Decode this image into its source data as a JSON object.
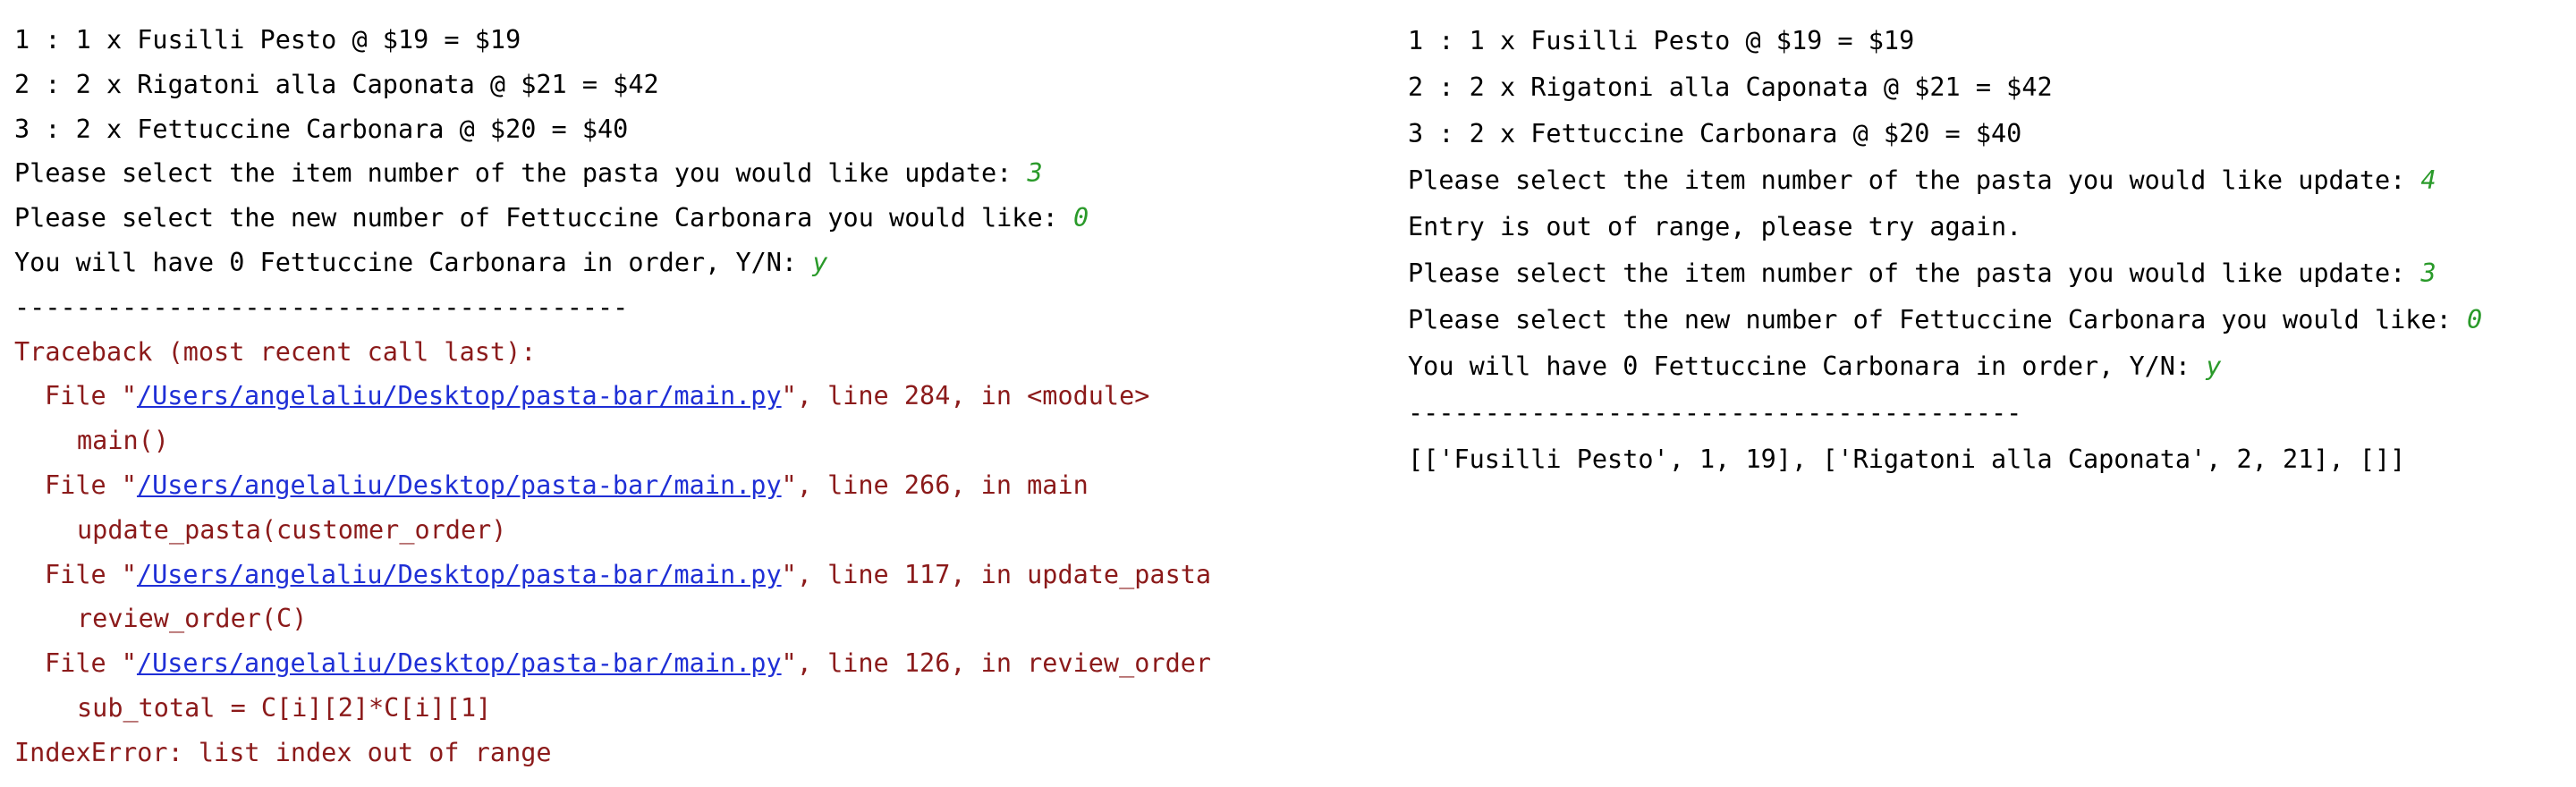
{
  "left": {
    "menu": [
      "1 : 1 x Fusilli Pesto @ $19 = $19",
      "2 : 2 x Rigatoni alla Caponata @ $21 = $42",
      "3 : 2 x Fettuccine Carbonara @ $20 = $40"
    ],
    "prompt_item": "Please select the item number of the pasta you would like update: ",
    "input_item": "3",
    "prompt_qty": "Please select the new number of Fettuccine Carbonara you would like: ",
    "input_qty": "0",
    "prompt_confirm": "You will have 0 Fettuccine Carbonara in order, Y/N: ",
    "input_confirm": "y",
    "separator": "----------------------------------------",
    "traceback": {
      "header": "Traceback (most recent call last):",
      "frames": [
        {
          "prefix": "File \"",
          "path": "/Users/angelaliu/Desktop/pasta-bar/main.py",
          "suffix": "\", line 284, in <module>",
          "code": "main()"
        },
        {
          "prefix": "File \"",
          "path": "/Users/angelaliu/Desktop/pasta-bar/main.py",
          "suffix": "\", line 266, in main",
          "code": "update_pasta(customer_order)"
        },
        {
          "prefix": "File \"",
          "path": "/Users/angelaliu/Desktop/pasta-bar/main.py",
          "suffix": "\", line 117, in update_pasta",
          "code": "review_order(C)"
        },
        {
          "prefix": "File \"",
          "path": "/Users/angelaliu/Desktop/pasta-bar/main.py",
          "suffix": "\", line 126, in review_order",
          "code": "sub_total = C[i][2]*C[i][1]"
        }
      ],
      "error": "IndexError: list index out of range"
    }
  },
  "right": {
    "menu": [
      "1 : 1 x Fusilli Pesto @ $19 = $19",
      "2 : 2 x Rigatoni alla Caponata @ $21 = $42",
      "3 : 2 x Fettuccine Carbonara @ $20 = $40"
    ],
    "prompt_item_1": "Please select the item number of the pasta you would like update: ",
    "input_item_1": "4",
    "out_of_range": "Entry is out of range, please try again.",
    "prompt_item_2": "Please select the item number of the pasta you would like update: ",
    "input_item_2": "3",
    "prompt_qty": "Please select the new number of Fettuccine Carbonara you would like: ",
    "input_qty": "0",
    "prompt_confirm": "You will have 0 Fettuccine Carbonara in order, Y/N: ",
    "input_confirm": "y",
    "separator": "----------------------------------------",
    "result": "[['Fusilli Pesto', 1, 19], ['Rigatoni alla Caponata', 2, 21], []]"
  },
  "colors": {
    "input": "#2a9a2a",
    "error": "#8b1a1a",
    "link": "#1f2fd6"
  }
}
